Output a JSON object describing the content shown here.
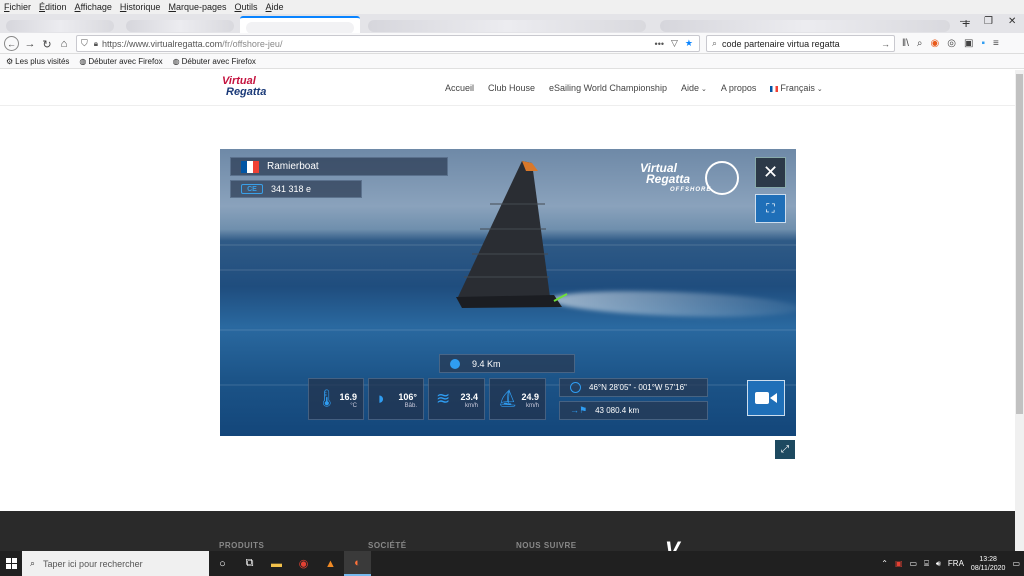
{
  "menubar": {
    "items": [
      "Fichier",
      "Édition",
      "Affichage",
      "Historique",
      "Marque-pages",
      "Outils",
      "Aide"
    ]
  },
  "browser": {
    "url_host": "https://www.virtualregatta.com",
    "url_path": "/fr/offshore-jeu/",
    "search_value": "code partenaire virtua regatta",
    "new_tab": "+",
    "window_minimize": "—",
    "window_restore": "❐",
    "window_close": "✕"
  },
  "bookmarks": {
    "items": [
      "Les plus visités",
      "Débuter avec Firefox",
      "Débuter avec Firefox"
    ]
  },
  "site": {
    "logo_line1": "Virtual",
    "logo_line2": "Regatta",
    "nav": [
      "Accueil",
      "Club House",
      "eSailing World Championship",
      "Aide",
      "A propos",
      "Français"
    ]
  },
  "game": {
    "player_name": "Ramierboat",
    "credits": "341 318 e",
    "credit_icon_label": "CE",
    "logo_line1": "Virtual",
    "logo_line2": "Regatta",
    "logo_sub": "OFFSHORE",
    "distance": "9.4 Km",
    "stats": {
      "temperature": {
        "value": "16.9",
        "unit": "°C"
      },
      "heading": {
        "value": "106°",
        "unit": "Bâb."
      },
      "wind": {
        "value": "23.4",
        "unit": "km/h"
      },
      "boat_speed": {
        "value": "24.9",
        "unit": "km/h"
      }
    },
    "position": "46°N 28'05\" - 001°W 57'16\"",
    "remaining": "43 080.4 km"
  },
  "footer": {
    "produits": "PRODUITS",
    "societe": "SOCIÉTÉ",
    "nous_suivre": "NOUS SUIVRE",
    "brand_partial": "V"
  },
  "taskbar": {
    "search_placeholder": "Taper ici pour rechercher",
    "language": "FRA",
    "time": "13:28",
    "date": "08/11/2020"
  },
  "colors": {
    "accent_blue": "#1f6fb8",
    "hud_icon_blue": "#2f9df2",
    "logo_red": "#c4133f"
  }
}
